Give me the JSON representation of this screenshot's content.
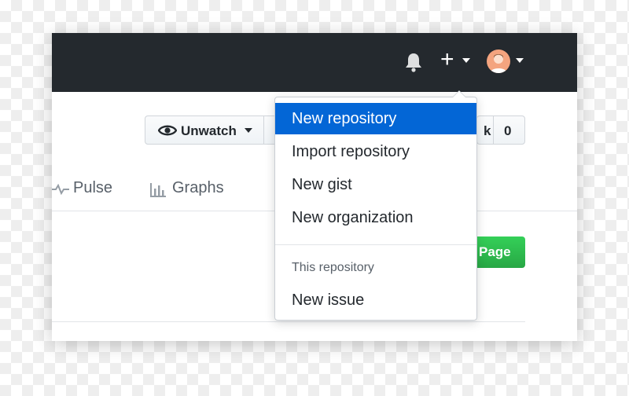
{
  "header": {
    "bell_icon": "bell-icon",
    "create_icon": "plus-icon",
    "create_label": "+",
    "avatar_icon": "avatar"
  },
  "repo_actions": {
    "unwatch_label": "Unwatch",
    "unwatch_icon": "eye-icon",
    "star_count_partial": "k",
    "star_count": "0"
  },
  "tabs": [
    {
      "label": "Pulse",
      "icon": "pulse-icon"
    },
    {
      "label": "Graphs",
      "icon": "graphs-icon"
    }
  ],
  "green_button": {
    "label": "Page"
  },
  "create_menu": {
    "items": [
      {
        "label": "New repository",
        "active": true
      },
      {
        "label": "Import repository",
        "active": false
      },
      {
        "label": "New gist",
        "active": false
      },
      {
        "label": "New organization",
        "active": false
      }
    ],
    "section_header": "This repository",
    "section_items": [
      {
        "label": "New issue"
      }
    ]
  },
  "colors": {
    "topbar": "#24292e",
    "accent": "#0366d6",
    "green": "#28a745"
  }
}
